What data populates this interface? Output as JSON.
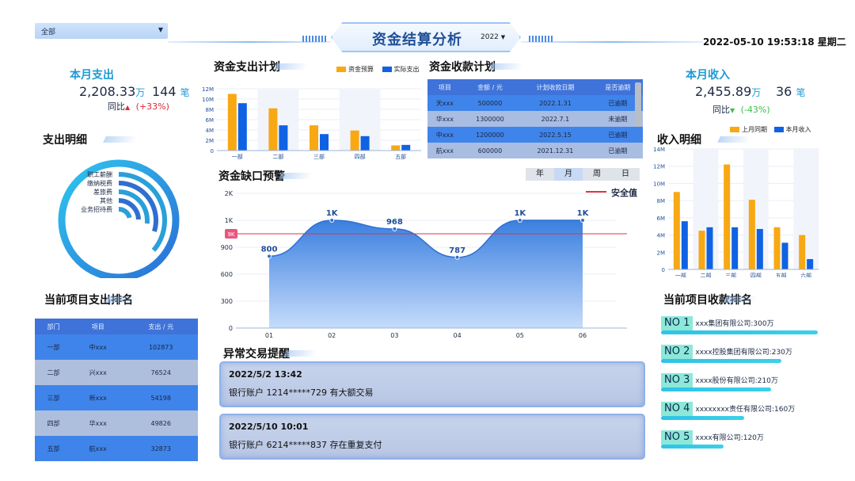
{
  "header": {
    "filter_value": "全部",
    "title": "资金结算分析",
    "year": "2022",
    "datetime": "2022-05-10 19:53:18 星期二"
  },
  "colors": {
    "orange": "#f7a813",
    "blue": "#0f62e3",
    "title_blue": "#1d9ad6",
    "red": "#e0283a",
    "green": "#3bbf46"
  },
  "expense_month": {
    "title": "本月支出",
    "amount": "2,208.33",
    "unit": "万",
    "count": "144",
    "count_unit": "笔",
    "compare_label": "同比",
    "compare_value": "(+33%)"
  },
  "income_month": {
    "title": "本月收入",
    "amount": "2,455.89",
    "unit": "万",
    "count": "36",
    "count_unit": "笔",
    "compare_label": "同比",
    "compare_value": "(-43%)"
  },
  "expense_detail": {
    "title": "支出明细",
    "items": [
      "职工薪酬",
      "缴纳税费",
      "差旅费",
      "其他",
      "业务招待费"
    ],
    "fractions": [
      0.88,
      0.62,
      0.5,
      0.4,
      0.28
    ]
  },
  "expense_plan": {
    "title": "资金支出计划",
    "legend": [
      "资金预算",
      "实际支出"
    ]
  },
  "collection_plan": {
    "title": "资金收款计划",
    "headers": [
      "项目",
      "金额 / 元",
      "计划收款日期",
      "是否逾期"
    ],
    "rows": [
      [
        "天xxx",
        "500000",
        "2022.1.31",
        "已逾期"
      ],
      [
        "华xxx",
        "1300000",
        "2022.7.1",
        "未逾期"
      ],
      [
        "中xxx",
        "1200000",
        "2022.5.15",
        "已逾期"
      ],
      [
        "航xxx",
        "600000",
        "2021.12.31",
        "已逾期"
      ]
    ]
  },
  "gap_warning": {
    "title": "资金缺口预警",
    "segments": [
      "年",
      "月",
      "周",
      "日"
    ],
    "safe_label": "安全值",
    "safe_tag": "9K"
  },
  "income_detail": {
    "title": "收入明细",
    "legend": [
      "上月同期",
      "本月收入"
    ]
  },
  "project_expense_rank": {
    "title": "当前项目支出排名",
    "headers": [
      "部门",
      "项目",
      "支出 / 元"
    ],
    "rows": [
      [
        "一部",
        "中xxx",
        "102873"
      ],
      [
        "二部",
        "兴xxx",
        "76524"
      ],
      [
        "三部",
        "新xxx",
        "54198"
      ],
      [
        "四部",
        "华xxx",
        "49826"
      ],
      [
        "五部",
        "航xxx",
        "32873"
      ]
    ]
  },
  "anomaly": {
    "title": "异常交易提醒",
    "items": [
      {
        "time": "2022/5/2 13:42",
        "desc": "银行账户 1214*****729 有大额交易"
      },
      {
        "time": "2022/5/10 10:01",
        "desc": "银行账户 6214*****837 存在重复支付"
      }
    ]
  },
  "collection_rank": {
    "title": "当前项目收款排名",
    "items": [
      {
        "no": "NO 1",
        "text": "xxx集团有限公司:300万",
        "fraction": 1.0
      },
      {
        "no": "NO 2",
        "text": "xxxx控股集团有限公司:230万",
        "fraction": 0.77
      },
      {
        "no": "NO 3",
        "text": "xxxx股份有限公司:210万",
        "fraction": 0.7
      },
      {
        "no": "NO 4",
        "text": "xxxxxxxx责任有限公司:160万",
        "fraction": 0.53
      },
      {
        "no": "NO 5",
        "text": "xxxx有限公司:120万",
        "fraction": 0.4
      }
    ]
  },
  "chart_data": [
    {
      "type": "bar",
      "categories": [
        "一部",
        "二部",
        "三部",
        "四部",
        "五部"
      ],
      "series": [
        {
          "name": "资金预算",
          "values": [
            11,
            8.2,
            4.9,
            3.9,
            1
          ]
        },
        {
          "name": "实际支出",
          "values": [
            9.2,
            4.9,
            3.2,
            2.8,
            1.1
          ]
        }
      ],
      "yticks": [
        "0",
        "2M",
        "4M",
        "6M",
        "8M",
        "10M",
        "12M"
      ],
      "ylim": [
        0,
        12
      ]
    },
    {
      "type": "area",
      "x": [
        "01",
        "02",
        "03",
        "04",
        "05",
        "06"
      ],
      "values": [
        800,
        1000,
        968,
        787,
        1000,
        1000
      ],
      "labels": [
        "800",
        "1K",
        "968",
        "787",
        "1K",
        "1K"
      ],
      "yticks": [
        "0",
        "300",
        "600",
        "900",
        "1K",
        "2K"
      ],
      "safe_line": 950
    },
    {
      "type": "bar",
      "categories": [
        "一部",
        "二部",
        "三部",
        "四部",
        "五部",
        "六部"
      ],
      "series": [
        {
          "name": "上月同期",
          "values": [
            9,
            4.5,
            12.2,
            8.1,
            4.9,
            4
          ]
        },
        {
          "name": "本月收入",
          "values": [
            5.6,
            4.9,
            4.9,
            4.7,
            3.1,
            1.2
          ]
        }
      ],
      "yticks": [
        "0",
        "2M",
        "4M",
        "6M",
        "8M",
        "10M",
        "12M",
        "14M"
      ],
      "ylim": [
        0,
        14
      ]
    }
  ]
}
